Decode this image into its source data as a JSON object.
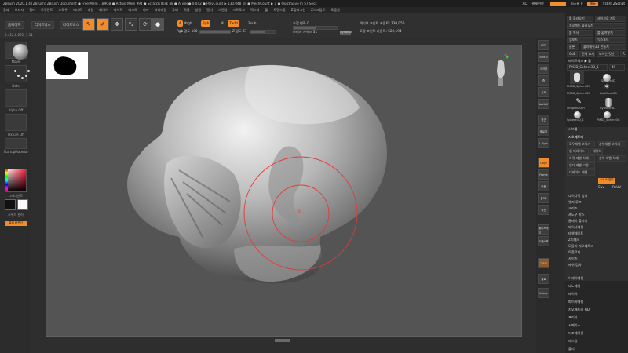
{
  "window": {
    "title": "ZBrush 2020.1.4 [ZBrush]   ZBrush Document   ● Free Mem 7.89GB ● Active Mem 994 ● Scratch Disk 48 ● ATime● 0.042 ● PolyCount ▶ 130.048 KP ● MeshCount ▶ 1 ● QuickSave In 57 Secs",
    "top_right": [
      "AC",
      "퀵세이브",
      "씨스룸 0",
      "메뉴",
      "디폴트 ZScript"
    ]
  },
  "menubar": [
    "알파",
    "브러시",
    "컬러",
    "도큐먼트",
    "드로우",
    "에디트",
    "파일",
    "레이어",
    "라이트",
    "매크로",
    "마커",
    "머티리얼",
    "무비",
    "픽셀",
    "설정",
    "렌더",
    "스텐실",
    "스트로크",
    "텍스처",
    "툴",
    "트랜스폼",
    "Z플러그인",
    "Z스크립트",
    "도움말"
  ],
  "toptools": {
    "home": "홈페이지",
    "lightbox": "라이트박스",
    "lightbox_brush": "라이트박스",
    "edit": "Edit",
    "draw": "Draw",
    "move": "Move",
    "scale": "Scale",
    "rotate": "Rotate",
    "mrgb": "Mrgb",
    "rgb": "Rgb",
    "m": "M",
    "zadd": "Zadd",
    "zsub": "Zsub",
    "rgb_intensity": "Rgb 강도 100",
    "z_intensity": "Z 강도 57",
    "focal_shift": "초점 변화 0",
    "draw_size": "브러시 사이즈 31",
    "dynamic": "Dynamic",
    "active_points": "액티브 포인트 카운트: 130,050",
    "total_points": "토탈 포인트 카운트: 520,194",
    "coords": "0.412,0.072,-1.11"
  },
  "leftshelf": {
    "brush": "Move",
    "stroke": "Dots",
    "alpha": "Alpha Off",
    "texture": "Texture Off",
    "material": "StartupMaterial",
    "gradient": "그라디언트",
    "switch": "스위치 컬러",
    "alternate": "컬러 바꾸기"
  },
  "rightshelf": [
    "BPR",
    "SPix 3",
    "스크롤",
    "줌",
    "실제",
    "AAHalf",
    "원근",
    "플로어",
    "L.Sym",
    "Qxyz",
    "Frame",
    "이동",
    "줌3D",
    "회전",
    "폴리프레임",
    "트랜스프",
    "고스트",
    "솔로",
    "Xpose"
  ],
  "tray": {
    "buttons": [
      "툴 불러오기",
      "세이브로 저장",
      "프로젝트 불러오기",
      "툴 불러오기",
      "툴 복사",
      "툴 붙여넣기",
      "임포트",
      "익스포트",
      "클론",
      "폴리메쉬3D 만들기",
      "GoZ",
      "전체 표시",
      "보이는 것만",
      "R"
    ],
    "lightbox_tools": "라이트박스 ▶ 툴",
    "current_tool": "PM3D_Sphere3D_1",
    "count": "49",
    "thumbs": [
      "PM3D_Sphere3C",
      "Sphere3D",
      "PolyMesh3D",
      "PM3D_Sphere3C",
      "SimpleBrush",
      "Cylinder3D",
      "Sphere3D_1",
      "PM3D_Sphere3C"
    ],
    "subtools": "서브툴",
    "geometry": "지오메트리",
    "geo_rows": [
      "로우레벨 보이기",
      "상위레벨 보이기",
      "업 디바이드",
      "세이브",
      "하위 레벨 삭제",
      "상위 레벨 삭제",
      "업디 레벨 고정",
      "디바이드 레벨"
    ],
    "smt": "스무스 업다",
    "suv": "Suv",
    "reuv": "ReUV",
    "geo_items": [
      "다이나믹 섭디",
      "엣지 루프",
      "크리즈",
      "섀도우 박스",
      "클레이 폴리시",
      "다이나메쉬",
      "테셀레이트",
      "Z리메셔",
      "모듈러 지오메트리",
      "토폴로지",
      "사이즈",
      "메쉬 검사"
    ],
    "menus": [
      "어레이메쉬",
      "나노메쉬",
      "레이어",
      "파이버메쉬",
      "지오메트리 HD",
      "프리뷰",
      "서페이스",
      "디포메이션",
      "마스킹",
      "폴리"
    ]
  }
}
